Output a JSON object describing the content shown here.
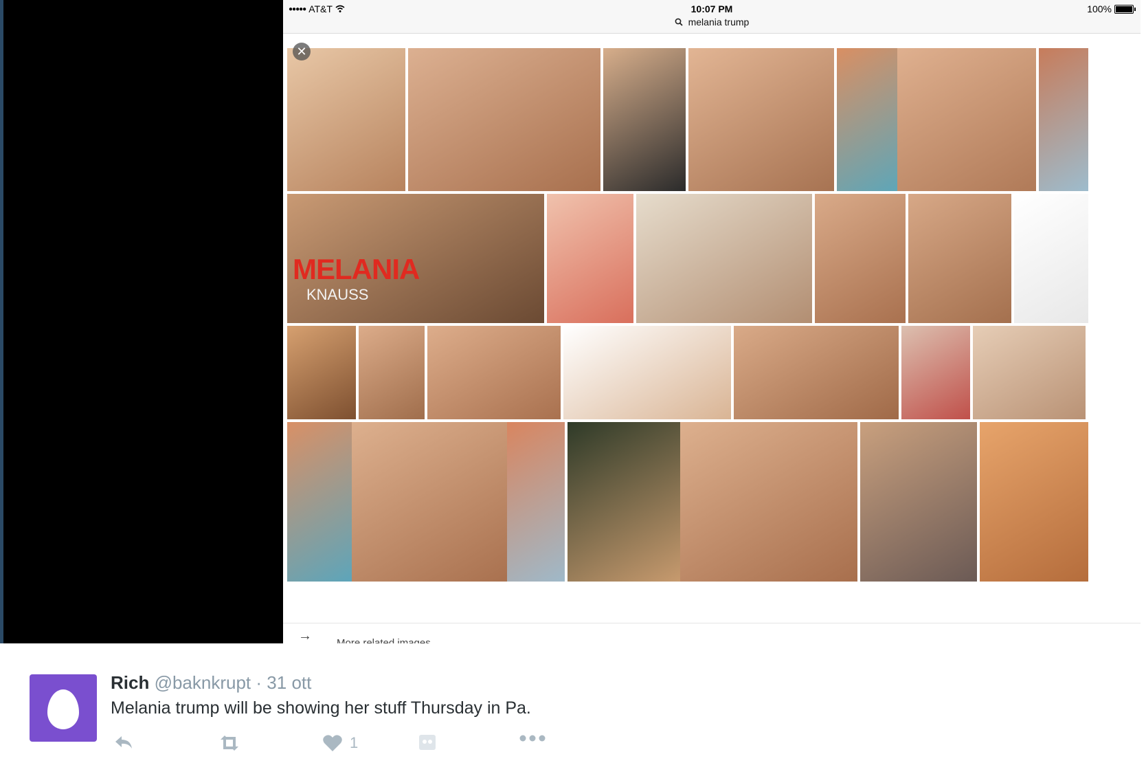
{
  "status_bar": {
    "carrier": "AT&T",
    "time": "10:07 PM",
    "battery": "100%"
  },
  "search": {
    "query": "melania trump",
    "close_symbol": "✕"
  },
  "images": [
    {
      "colors": [
        "#e8c7a6",
        "#b7835e"
      ]
    },
    {
      "colors": [
        "#dcb091",
        "#a8704e"
      ]
    },
    {
      "colors": [
        "#d7ae8b",
        "#2b2b2b"
      ]
    },
    {
      "colors": [
        "#e2b594",
        "#a77352"
      ]
    },
    {
      "colors": [
        "#d98f63",
        "#5ea6b8"
      ]
    },
    {
      "colors": [
        "#dfb08f",
        "#b07a58"
      ]
    },
    {
      "colors": [
        "#c77c5b",
        "#9dbccd"
      ]
    },
    {
      "colors": [
        "#c99a74",
        "#6b4a33"
      ],
      "overlay_title": "MELANIA",
      "overlay_subtitle": "KNAUSS"
    },
    {
      "colors": [
        "#f0c2ad",
        "#d96f5c"
      ]
    },
    {
      "colors": [
        "#e6dccc",
        "#b28e72"
      ]
    },
    {
      "colors": [
        "#d9aa89",
        "#a9714f"
      ]
    },
    {
      "colors": [
        "#d7a887",
        "#a4704e"
      ]
    },
    {
      "colors": [
        "#ffffff",
        "#e8e8e8"
      ]
    },
    {
      "colors": [
        "#d6a070",
        "#7e5030"
      ]
    },
    {
      "colors": [
        "#dcac8a",
        "#a06e4c"
      ]
    },
    {
      "colors": [
        "#ddad8b",
        "#a9714f"
      ]
    },
    {
      "colors": [
        "#ffffff",
        "#d9b494"
      ]
    },
    {
      "colors": [
        "#d9aa88",
        "#a06a48"
      ]
    },
    {
      "colors": [
        "#dcc0b0",
        "#c0504a"
      ]
    },
    {
      "colors": [
        "#e6cdb6",
        "#b99275"
      ]
    },
    {
      "colors": [
        "#d99066",
        "#5da5ba"
      ]
    },
    {
      "colors": [
        "#ddb08e",
        "#a9714f"
      ]
    },
    {
      "colors": [
        "#d9855f",
        "#9fb9c9"
      ]
    },
    {
      "colors": [
        "#2e3a28",
        "#c79a6e"
      ]
    },
    {
      "colors": [
        "#ddb08e",
        "#a86f4d"
      ]
    },
    {
      "colors": [
        "#c9a07e",
        "#6b5a55"
      ]
    },
    {
      "colors": [
        "#e7a46b",
        "#b56d3c"
      ]
    }
  ],
  "more_related": {
    "label": "More related images"
  },
  "tweet": {
    "name": "Rich",
    "handle": "@baknkrupt",
    "separator": "·",
    "date": "31 ott",
    "text": "Melania trump will be showing her stuff Thursday in Pa.",
    "like_count": "1",
    "avatar_color": "#7a4fcf"
  }
}
